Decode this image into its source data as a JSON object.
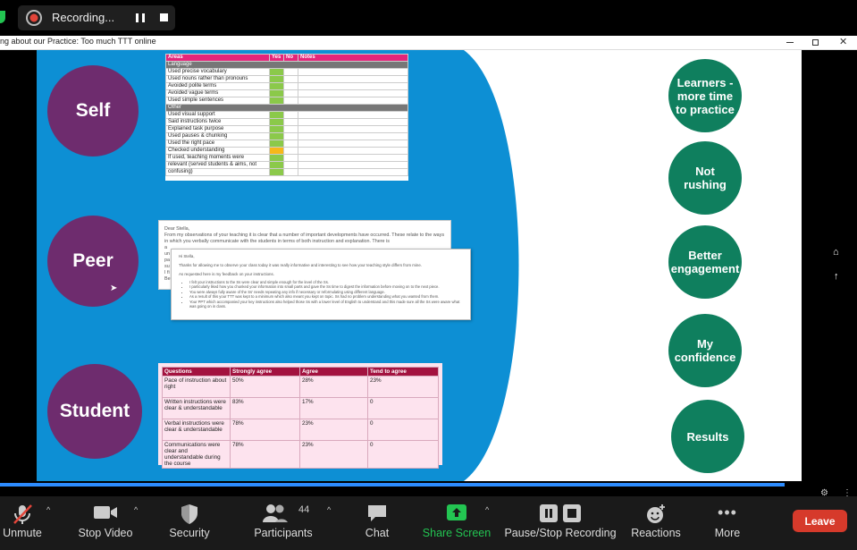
{
  "recording": {
    "label": "Recording..."
  },
  "window": {
    "title": "ng about our Practice: Too much TTT online"
  },
  "self_circle": "Self",
  "peer_circle": "Peer",
  "student_circle": "Student",
  "outcomes": [
    "Learners - more time to practice",
    "Not rushing",
    "Better engagement",
    "My confidence",
    "Results"
  ],
  "self_table": {
    "headers": [
      "Areas",
      "Yes",
      "No",
      "Notes"
    ],
    "rows": [
      {
        "t": "Language",
        "sec": true
      },
      {
        "t": "Used precise vocabulary"
      },
      {
        "t": "Used nouns rather than pronouns"
      },
      {
        "t": "Avoided polite terms"
      },
      {
        "t": "Avoided vague terms"
      },
      {
        "t": "Used simple sentences"
      },
      {
        "t": "Other",
        "sec": true
      },
      {
        "t": "Used visual support"
      },
      {
        "t": "Said instructions twice"
      },
      {
        "t": "Explained task purpose"
      },
      {
        "t": "Used pauses & chunking"
      },
      {
        "t": "Used the right pace"
      },
      {
        "t": "Checked understanding",
        "flag": "yellow"
      },
      {
        "t": "If used, teaching moments were"
      },
      {
        "t": "relevant (served students & aims, not"
      },
      {
        "t": "confusing)"
      }
    ]
  },
  "peer_letter1": {
    "greeting": "Dear Stella,",
    "body": "From my observations of your teaching it is clear that a number of important developments have occurred. These relate to the ways in which you verbally communicate with the students in terms of both instruction and explanation. There is",
    "side": [
      "a",
      "un",
      "pa",
      "su",
      "I fi",
      "Be"
    ]
  },
  "peer_letter2": {
    "greeting": "Hi Stella,",
    "intro": "Thanks for allowing me to observe your class today it was really informative and interesting to see how your teaching style differs from mine.",
    "lead": "As requested here is my feedback on your instructions.",
    "bullets": [
      "I felt your instructions to the Ss were clear and simple enough for the level of the Ss.",
      "I particularly liked how you chunked your information into small parts and gave the Ss time to digest the information before moving on to the next piece.",
      "You were always fully aware of the Ss' needs repeating any info if necessary or reformulating using different language.",
      "As a result of this your TTT was kept to a minimum which also meant you kept on topic. Ss had no problem understanding what you wanted from them.",
      "Your PPT which accompanied your key instructions also helped those Ss with a lower level of English to understand and this made sure all the Ss were aware what was going on in class."
    ]
  },
  "student_table": {
    "headers": [
      "Questions",
      "Strongly agree",
      "Agree",
      "Tend to agree"
    ],
    "rows": [
      [
        "Pace of instruction about right",
        "50%",
        "28%",
        "23%"
      ],
      [
        "Written instructions were clear & understandable",
        "83%",
        "17%",
        "0"
      ],
      [
        "Verbal instructions were clear & understandable",
        "78%",
        "23%",
        "0"
      ],
      [
        "Communications were clear and understandable during the course",
        "78%",
        "23%",
        "0"
      ]
    ]
  },
  "toolbar": {
    "unmute": "Unmute",
    "stop_video": "Stop Video",
    "security": "Security",
    "participants": "Participants",
    "participants_count": "44",
    "chat": "Chat",
    "share_screen": "Share Screen",
    "pause_stop": "Pause/Stop Recording",
    "reactions": "Reactions",
    "more": "More",
    "leave": "Leave"
  },
  "colors": {
    "slide_blue": "#0d8fd4",
    "purple": "#6e2c6e",
    "green": "#0f7f5e",
    "leave": "#d63a2b",
    "share": "#23c552"
  }
}
